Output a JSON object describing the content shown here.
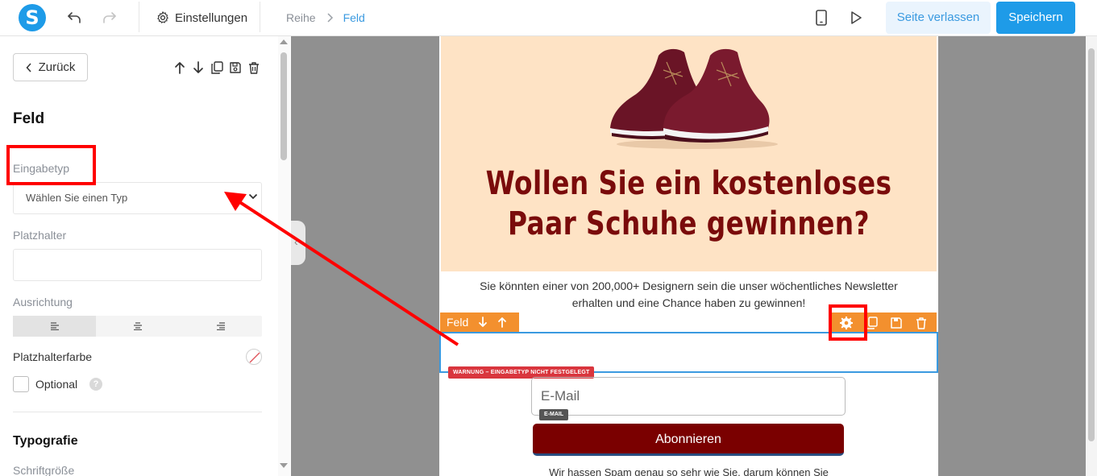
{
  "topbar": {
    "logo_letter": "S",
    "settings_label": "Einstellungen",
    "breadcrumb": [
      "Reihe",
      "Feld"
    ],
    "leave_label": "Seite verlassen",
    "save_label": "Speichern"
  },
  "panel": {
    "back_label": "Zurück",
    "title": "Feld",
    "input_type_label": "Eingabetyp",
    "input_type_placeholder": "Wählen Sie einen Typ",
    "placeholder_label": "Platzhalter",
    "placeholder_value": "",
    "alignment_label": "Ausrichtung",
    "alignment_options": [
      "left",
      "center",
      "right"
    ],
    "alignment_selected": "left",
    "placeholder_color_label": "Platzhalterfarbe",
    "optional_label": "Optional",
    "optional_checked": false,
    "help_glyph": "?",
    "typography_title": "Typografie",
    "font_size_label": "Schriftgröße"
  },
  "page": {
    "hero_title_line1": "Wollen Sie ein kostenloses",
    "hero_title_line2": "Paar Schuhe gewinnen?",
    "intro_line1": "Sie könnten einer von 200,000+ Designern sein die unser wöchentliches Newsletter",
    "intro_line2": "erhalten und eine Chance haben zu gewinnen!",
    "field_bar_label": "Feld",
    "warning": "WARNUNG – EINGABETYP NICHT FESTGELEGT",
    "email_placeholder": "E-Mail",
    "email_tag": "E-MAIL",
    "subscribe_label": "Abonnieren",
    "footer_text": "Wir hassen Spam genau so sehr wie Sie, darum können Sie"
  },
  "colors": {
    "accent": "#1e9be8",
    "orange_toolbar": "#f3902e",
    "hero_bg": "#fee3c5",
    "hero_text": "#7a0b0b",
    "subscribe_bg": "#7a0000",
    "warning_bg": "#d9363e",
    "annotation": "#ff0000"
  },
  "icons": [
    "undo-icon",
    "redo-icon",
    "gear-icon",
    "chevron-right-icon",
    "mobile-icon",
    "play-icon",
    "chevron-left-icon",
    "arrow-up-icon",
    "arrow-down-icon",
    "copy-icon",
    "save-icon",
    "trash-icon",
    "chevron-down-icon",
    "align-left-icon",
    "align-center-icon",
    "align-right-icon",
    "help-icon"
  ]
}
